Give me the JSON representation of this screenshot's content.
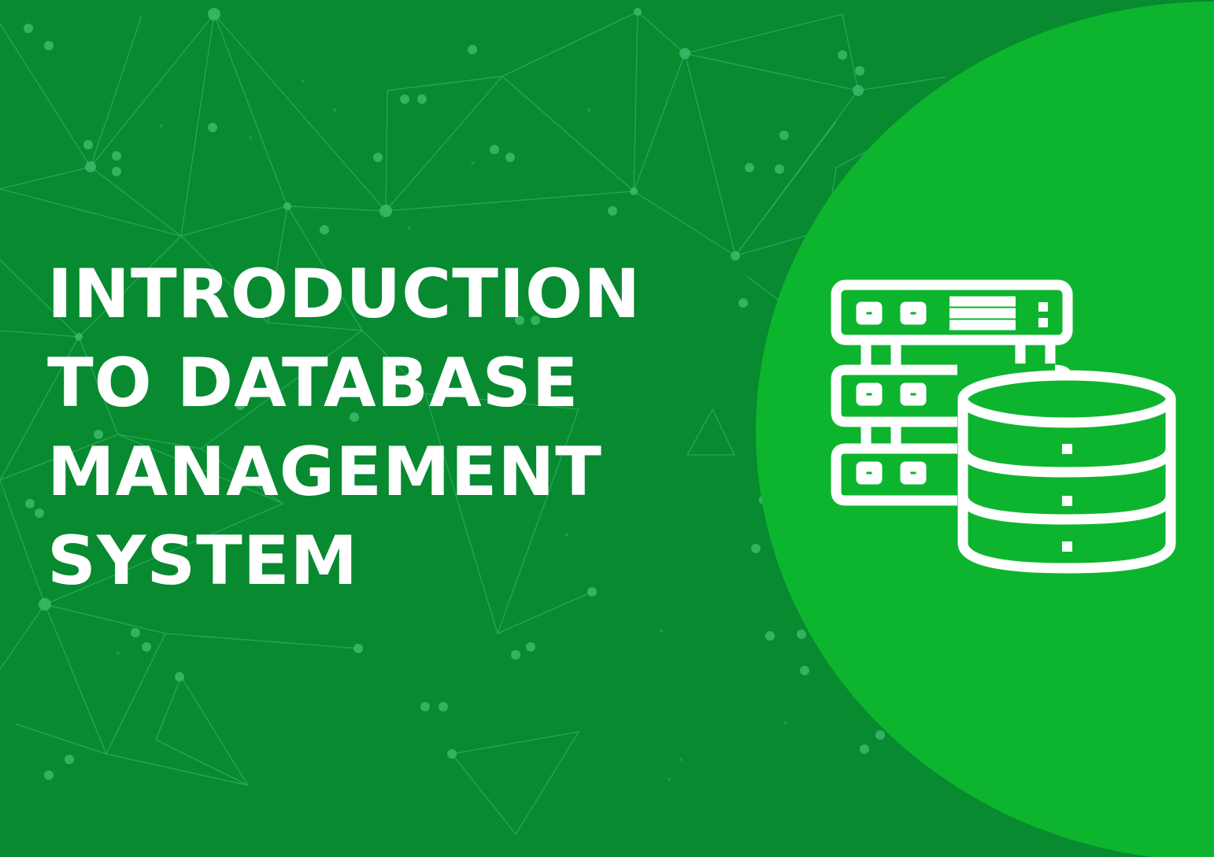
{
  "colors": {
    "background": "#078a30",
    "circle": "#0db52e",
    "network_line": "#34b066",
    "text": "#ffffff",
    "icon_stroke": "#ffffff"
  },
  "title": {
    "line1": "INTRODUCTION",
    "line2": "TO DATABASE",
    "line3": "MANAGEMENT",
    "line4": "SYSTEM"
  },
  "icons": {
    "background": "network-mesh-pattern",
    "main": "database-server-icon"
  }
}
